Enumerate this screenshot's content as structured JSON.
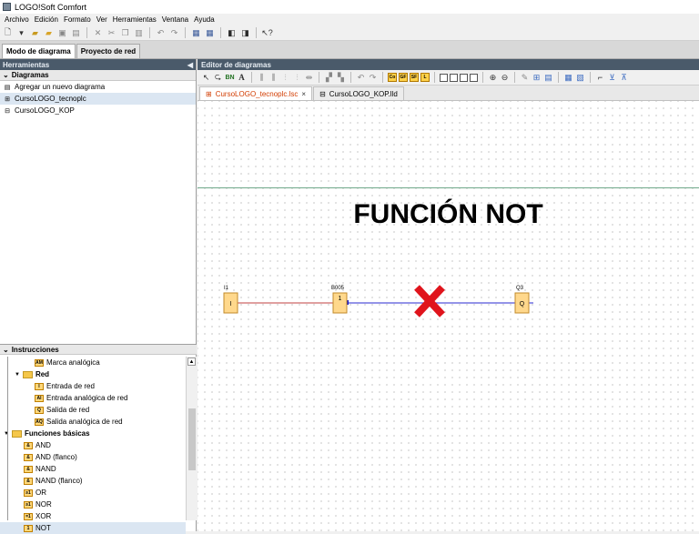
{
  "window": {
    "title": "LOGO!Soft Comfort"
  },
  "menu": [
    "Archivo",
    "Edición",
    "Formato",
    "Ver",
    "Herramientas",
    "Ventana",
    "Ayuda"
  ],
  "mode_tabs": {
    "diagram": "Modo de diagrama",
    "network": "Proyecto de red"
  },
  "tools_panel": {
    "title": "Herramientas",
    "diagrams_header": "Diagramas",
    "diagrams": [
      {
        "label": "Agregar un nuevo diagrama",
        "icon": "add-diagram-icon"
      },
      {
        "label": "CursoLOGO_tecnoplc",
        "icon": "fbd-diagram-icon"
      },
      {
        "label": "CursoLOGO_KOP",
        "icon": "ladder-diagram-icon"
      }
    ]
  },
  "instructions": {
    "header": "Instrucciones",
    "items": [
      {
        "label": "Marca analógica",
        "badge": "AM"
      },
      {
        "label": "Red",
        "group": true
      },
      {
        "label": "Entrada de red",
        "badge": "I"
      },
      {
        "label": "Entrada analógica de red",
        "badge": "AI"
      },
      {
        "label": "Salida de red",
        "badge": "Q"
      },
      {
        "label": "Salida analógica de red",
        "badge": "AQ"
      },
      {
        "label": "Funciones básicas",
        "group": true
      },
      {
        "label": "AND",
        "badge": "&"
      },
      {
        "label": "AND (flanco)",
        "badge": "&"
      },
      {
        "label": "NAND",
        "badge": "&"
      },
      {
        "label": "NAND (flanco)",
        "badge": "&"
      },
      {
        "label": "OR",
        "badge": "≥1"
      },
      {
        "label": "NOR",
        "badge": "≥1"
      },
      {
        "label": "XOR",
        "badge": "=1"
      },
      {
        "label": "NOT",
        "badge": "1"
      }
    ]
  },
  "editor": {
    "title": "Editor de diagramas",
    "toolbar_badges": [
      "Co",
      "GF",
      "SF",
      "L"
    ],
    "tabs": [
      {
        "label": "CursoLOGO_tecnoplc.lsc",
        "active": true
      },
      {
        "label": "CursoLOGO_KOP.lld",
        "active": false
      }
    ],
    "diagram": {
      "title": "FUNCIÓN NOT",
      "blocks": [
        {
          "id": "I1",
          "tag": "I1",
          "symbol": "I"
        },
        {
          "id": "B005",
          "tag": "B005",
          "symbol": "1"
        },
        {
          "id": "Q3",
          "tag": "Q3",
          "symbol": "Q"
        }
      ],
      "colors": {
        "block_fill": "#ffd88c",
        "block_border": "#c08a2a",
        "wire_input": "#c04040",
        "wire_output": "#2a2ad0",
        "cross": "#e0141c"
      }
    }
  }
}
